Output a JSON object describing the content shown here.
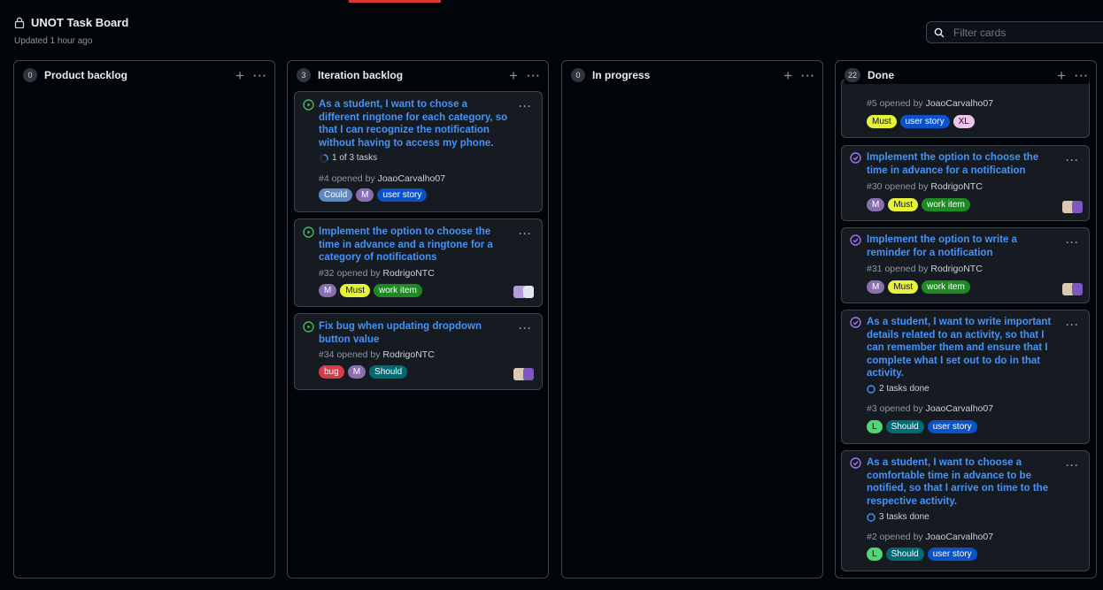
{
  "board": {
    "title": "UNOT Task Board",
    "updated": "Updated 1 hour ago",
    "filter_placeholder": "Filter cards"
  },
  "colors": {
    "open": "#3fb950",
    "closed": "#a371f7",
    "link": "#4493f8"
  },
  "columns": [
    {
      "count": "0",
      "name": "Product backlog"
    },
    {
      "count": "3",
      "name": "Iteration backlog"
    },
    {
      "count": "0",
      "name": "In progress"
    },
    {
      "count": "22",
      "name": "Done"
    }
  ],
  "cards": {
    "iter1": {
      "title_lines": [
        "As a student, I want to chose a",
        "different ringtone for each category, so",
        "that I can recognize the notification",
        "without having to access my phone."
      ],
      "tasks": "1 of 3 tasks",
      "number": "#4",
      "opened_by": "opened by",
      "author": "JoaoCarvalho07",
      "labels": [
        "Could",
        "M",
        "user story"
      ],
      "status": "open"
    },
    "iter2": {
      "title_lines": [
        "Implement the option to choose the",
        "time in advance and a ringtone for a",
        "category of notifications"
      ],
      "number": "#32",
      "opened_by": "opened by",
      "author": "RodrigoNTC",
      "labels": [
        "M",
        "Must",
        "work item"
      ],
      "status": "open"
    },
    "iter3": {
      "title_lines": [
        "Fix bug when updating dropdown",
        "button value"
      ],
      "number": "#34",
      "opened_by": "opened by",
      "author": "RodrigoNTC",
      "labels": [
        "bug",
        "M",
        "Should"
      ],
      "status": "open"
    },
    "done0": {
      "number": "#5",
      "opened_by": "opened by",
      "author": "JoaoCarvalho07",
      "labels": [
        "Must",
        "user story",
        "XL"
      ]
    },
    "done1": {
      "title_lines": [
        "Implement the option to choose the",
        "time in advance for a notification"
      ],
      "number": "#30",
      "opened_by": "opened by",
      "author": "RodrigoNTC",
      "labels": [
        "M",
        "Must",
        "work item"
      ],
      "status": "closed"
    },
    "done2": {
      "title_lines": [
        "Implement the option to write a",
        "reminder for a notification"
      ],
      "number": "#31",
      "opened_by": "opened by",
      "author": "RodrigoNTC",
      "labels": [
        "M",
        "Must",
        "work item"
      ],
      "status": "closed"
    },
    "done3": {
      "title_lines": [
        "As a student, I want to write important",
        "details related to an activity, so that I",
        "can remember them and ensure that I",
        "complete what I set out to do in that",
        "activity."
      ],
      "tasks": "2 tasks done",
      "number": "#3",
      "opened_by": "opened by",
      "author": "JoaoCarvalho07",
      "labels": [
        "L",
        "Should",
        "user story"
      ],
      "status": "closed"
    },
    "done4": {
      "title_lines": [
        "As a student, I want to choose a",
        "comfortable time in advance to be",
        "notified, so that I arrive on time to the",
        "respective activity."
      ],
      "tasks": "3 tasks done",
      "number": "#2",
      "opened_by": "opened by",
      "author": "JoaoCarvalho07",
      "labels": [
        "L",
        "Should",
        "user story"
      ],
      "status": "closed"
    }
  }
}
